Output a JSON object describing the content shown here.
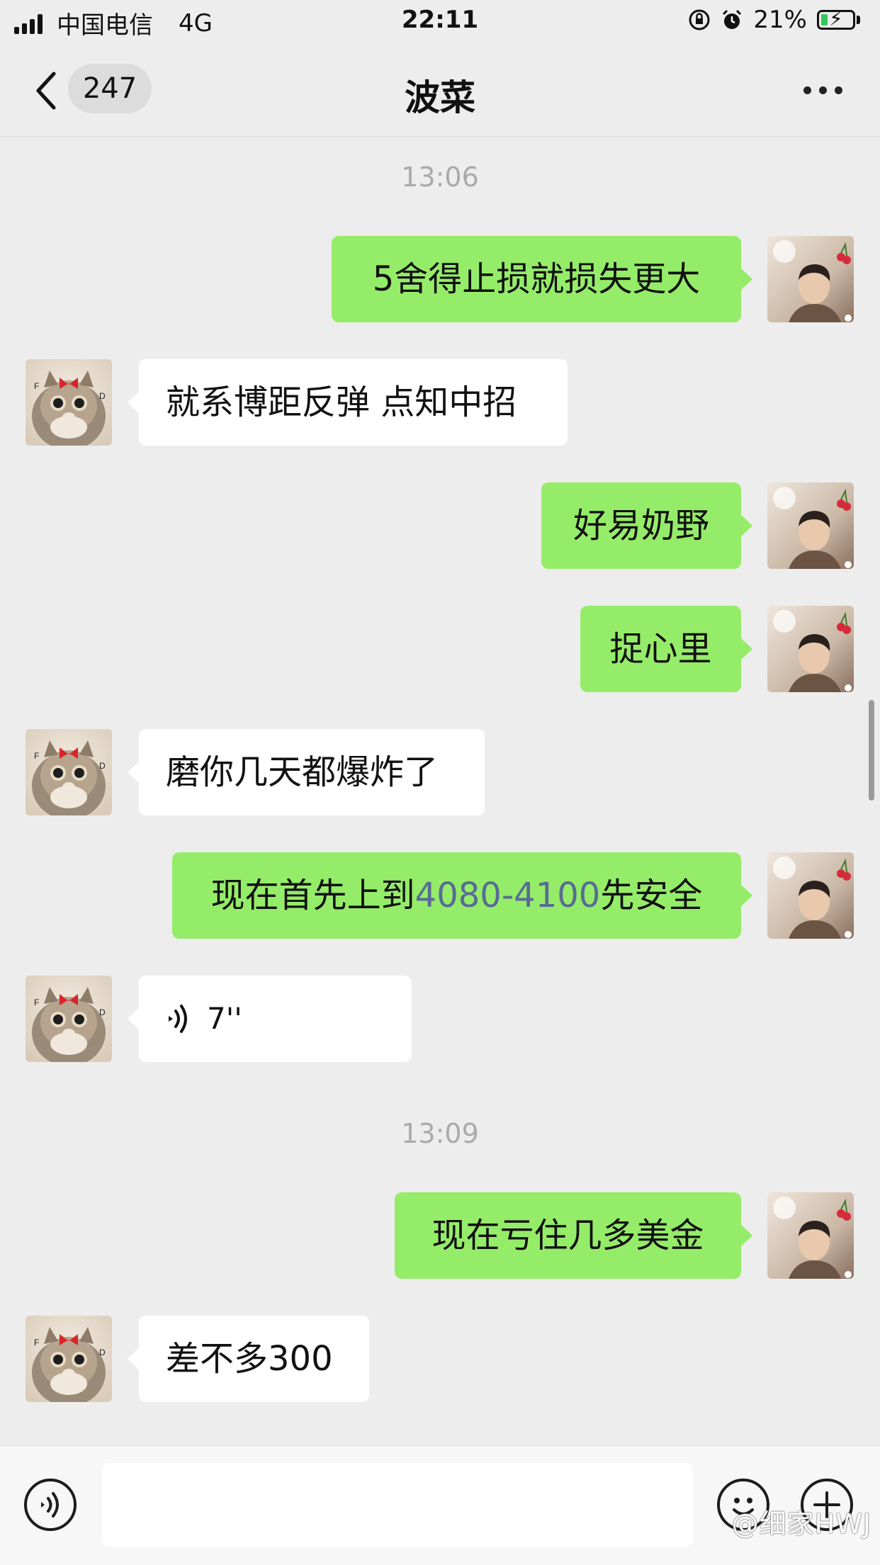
{
  "status_bar": {
    "carrier": "中国电信",
    "network": "4G",
    "time": "22:11",
    "battery": "21%",
    "battery_level": 0.21
  },
  "header": {
    "back_icon": "chevron-left-icon",
    "unread_count": "247",
    "title": "波菜",
    "more_icon": "more-dots-icon"
  },
  "chat": {
    "timestamps": [
      "13:06",
      "13:09"
    ],
    "messages": [
      {
        "side": "out",
        "text": "5舍得止损就损失更大"
      },
      {
        "side": "in",
        "text": "就系博距反弹 点知中招"
      },
      {
        "side": "out",
        "text": "好易奶野"
      },
      {
        "side": "out",
        "text": "捉心里"
      },
      {
        "side": "in",
        "text": "磨你几天都爆炸了"
      },
      {
        "side": "out",
        "text_before": "现在首先上到",
        "link": "4080-4100",
        "text_after": "先安全"
      },
      {
        "side": "in",
        "type": "voice",
        "duration": "7''"
      },
      {
        "side": "out",
        "text": "现在亏住几多美金"
      },
      {
        "side": "in",
        "text": "差不多300"
      }
    ]
  },
  "input_bar": {
    "voice_icon": "voice-input-icon",
    "emoji_icon": "emoji-icon",
    "plus_icon": "plus-icon"
  },
  "watermark": "@细家HWJ",
  "colors": {
    "outgoing_bubble": "#95ec69",
    "incoming_bubble": "#ffffff",
    "background": "#ededed",
    "link": "#576b95"
  }
}
